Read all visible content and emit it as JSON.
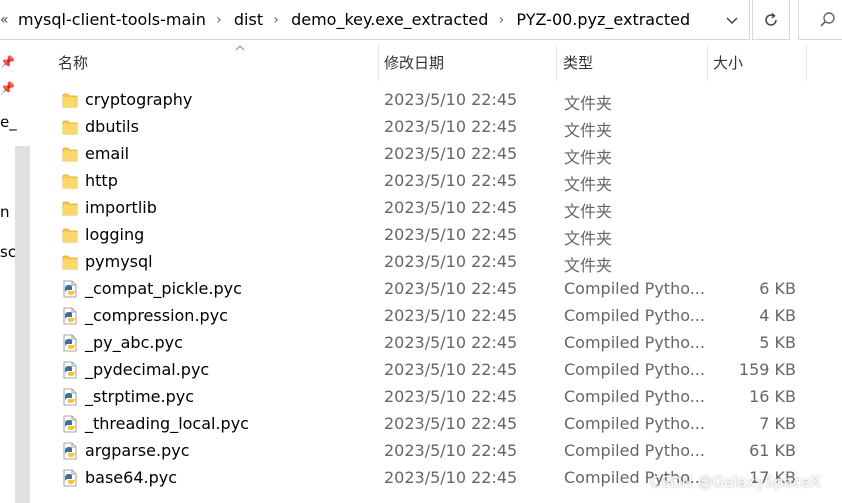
{
  "breadcrumb": {
    "overflow": "«",
    "items": [
      "mysql-client-tools-main",
      "dist",
      "demo_key.exe_extracted",
      "PYZ-00.pyz_extracted"
    ],
    "separator": "›"
  },
  "nav_fragments": [
    "e_",
    "n",
    "sc"
  ],
  "columns": {
    "name": "名称",
    "date": "修改日期",
    "type": "类型",
    "size": "大小"
  },
  "files": [
    {
      "name": "cryptography",
      "date": "2023/5/10 22:45",
      "type": "文件夹",
      "size": "",
      "kind": "folder"
    },
    {
      "name": "dbutils",
      "date": "2023/5/10 22:45",
      "type": "文件夹",
      "size": "",
      "kind": "folder"
    },
    {
      "name": "email",
      "date": "2023/5/10 22:45",
      "type": "文件夹",
      "size": "",
      "kind": "folder"
    },
    {
      "name": "http",
      "date": "2023/5/10 22:45",
      "type": "文件夹",
      "size": "",
      "kind": "folder"
    },
    {
      "name": "importlib",
      "date": "2023/5/10 22:45",
      "type": "文件夹",
      "size": "",
      "kind": "folder"
    },
    {
      "name": "logging",
      "date": "2023/5/10 22:45",
      "type": "文件夹",
      "size": "",
      "kind": "folder"
    },
    {
      "name": "pymysql",
      "date": "2023/5/10 22:45",
      "type": "文件夹",
      "size": "",
      "kind": "folder"
    },
    {
      "name": "_compat_pickle.pyc",
      "date": "2023/5/10 22:45",
      "type": "Compiled Pytho...",
      "size": "6 KB",
      "kind": "pyc"
    },
    {
      "name": "_compression.pyc",
      "date": "2023/5/10 22:45",
      "type": "Compiled Pytho...",
      "size": "4 KB",
      "kind": "pyc"
    },
    {
      "name": "_py_abc.pyc",
      "date": "2023/5/10 22:45",
      "type": "Compiled Pytho...",
      "size": "5 KB",
      "kind": "pyc"
    },
    {
      "name": "_pydecimal.pyc",
      "date": "2023/5/10 22:45",
      "type": "Compiled Pytho...",
      "size": "159 KB",
      "kind": "pyc"
    },
    {
      "name": "_strptime.pyc",
      "date": "2023/5/10 22:45",
      "type": "Compiled Pytho...",
      "size": "16 KB",
      "kind": "pyc"
    },
    {
      "name": "_threading_local.pyc",
      "date": "2023/5/10 22:45",
      "type": "Compiled Pytho...",
      "size": "7 KB",
      "kind": "pyc"
    },
    {
      "name": "argparse.pyc",
      "date": "2023/5/10 22:45",
      "type": "Compiled Pytho...",
      "size": "61 KB",
      "kind": "pyc"
    },
    {
      "name": "base64.pyc",
      "date": "2023/5/10 22:45",
      "type": "Compiled Pytho...",
      "size": "17 KB",
      "kind": "pyc"
    }
  ],
  "watermark": "CSDN @GalaxySpaceX",
  "colors": {
    "folder": "#f8c846",
    "python_blue": "#3a6ea5",
    "python_yellow": "#f3c63f",
    "meta_text": "#666666",
    "border": "#d9d9d9"
  }
}
